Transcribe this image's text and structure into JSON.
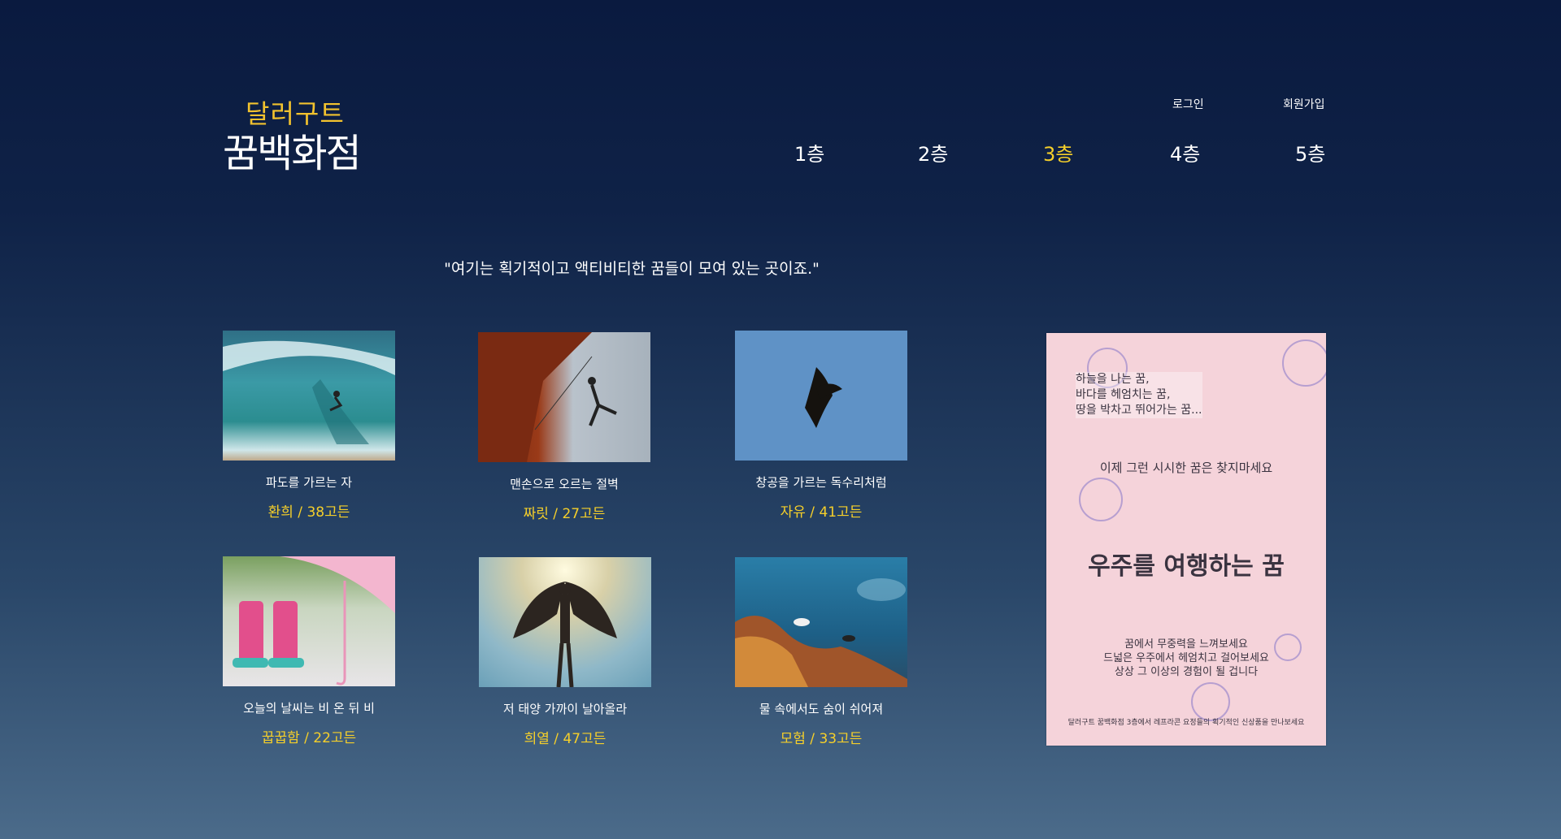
{
  "logo": {
    "line1": "달러구트",
    "line2": "꿈백화점"
  },
  "auth": {
    "login": "로그인",
    "signup": "회원가입"
  },
  "nav": [
    "1층",
    "2층",
    "3층",
    "4층",
    "5층"
  ],
  "tagline": "\"여기는 획기적이고 액티비티한 꿈들이 모여 있는 곳이죠.\"",
  "products": [
    {
      "title": "파도를 가르는 자",
      "price": "환희 / 38고든"
    },
    {
      "title": "맨손으로 오르는 절벽",
      "price": "짜릿 / 27고든"
    },
    {
      "title": "창공을 가르는 독수리처럼",
      "price": "자유 / 41고든"
    },
    {
      "title": "오늘의 날씨는 비 온 뒤 비",
      "price": "꿉꿉함 / 22고든"
    },
    {
      "title": "저 태양 가까이 날아올라",
      "price": "희열 / 47고든"
    },
    {
      "title": "물 속에서도 숨이 쉬어져",
      "price": "모험 / 33고든"
    }
  ],
  "poster": {
    "intro": [
      "하늘을 나는 꿈,",
      "바다를 헤엄치는 꿈,",
      "땅을 박차고 뛰어가는 꿈..."
    ],
    "sub": "이제 그런 시시한 꿈은 찾지마세요",
    "headline": "우주를 여행하는 꿈",
    "body": [
      "꿈에서 무중력을 느껴보세요",
      "드넓은 우주에서 헤엄치고 걸어보세요",
      "상상 그 이상의 경험이 될 겁니다"
    ],
    "footer": "달러구트 꿈백화점 3층에서 레프라콘 요정들의 획기적인 신상품을 만나보세요"
  }
}
